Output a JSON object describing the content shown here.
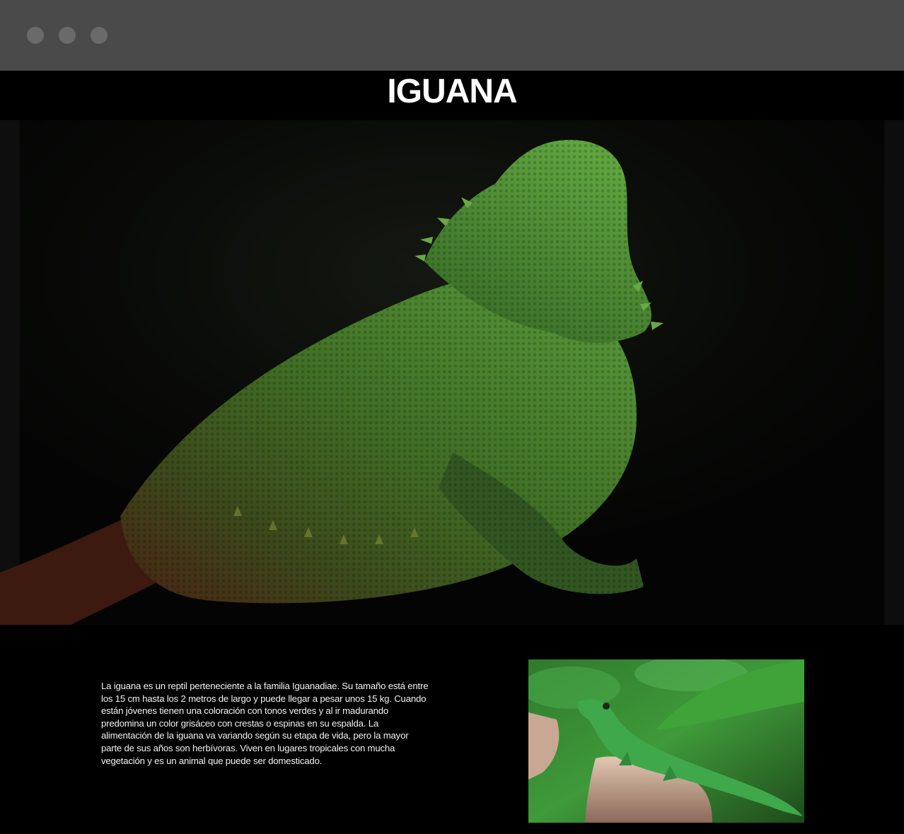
{
  "window": {
    "controls": [
      "close-dot",
      "minimize-dot",
      "maximize-dot"
    ]
  },
  "header": {
    "title": "IGUANA"
  },
  "hero": {
    "image_alt_icon": "bearded-dragon-photo"
  },
  "main": {
    "description": "La iguana es un reptil perteneciente a la familia Iguanadiae. Su tamaño está entre los 15 cm hasta los 2 metros de largo y puede llegar a pesar unos 15 kg. Cuando están jóvenes tienen una coloración con tonos verdes y al ir madurando predomina un color grisáceo con crestas o espinas en su espalda. La alimentación de la iguana va variando según su etapa de vida, pero la mayor parte de sus años son herbívoras. Viven en lugares tropicales con mucha vegetación y es un animal que puede ser domesticado.",
    "thumbnail_icon": "green-iguana-photo"
  },
  "colors": {
    "window_bar": "#4a4a4a",
    "background": "#000000",
    "title_text": "#ffffff"
  }
}
